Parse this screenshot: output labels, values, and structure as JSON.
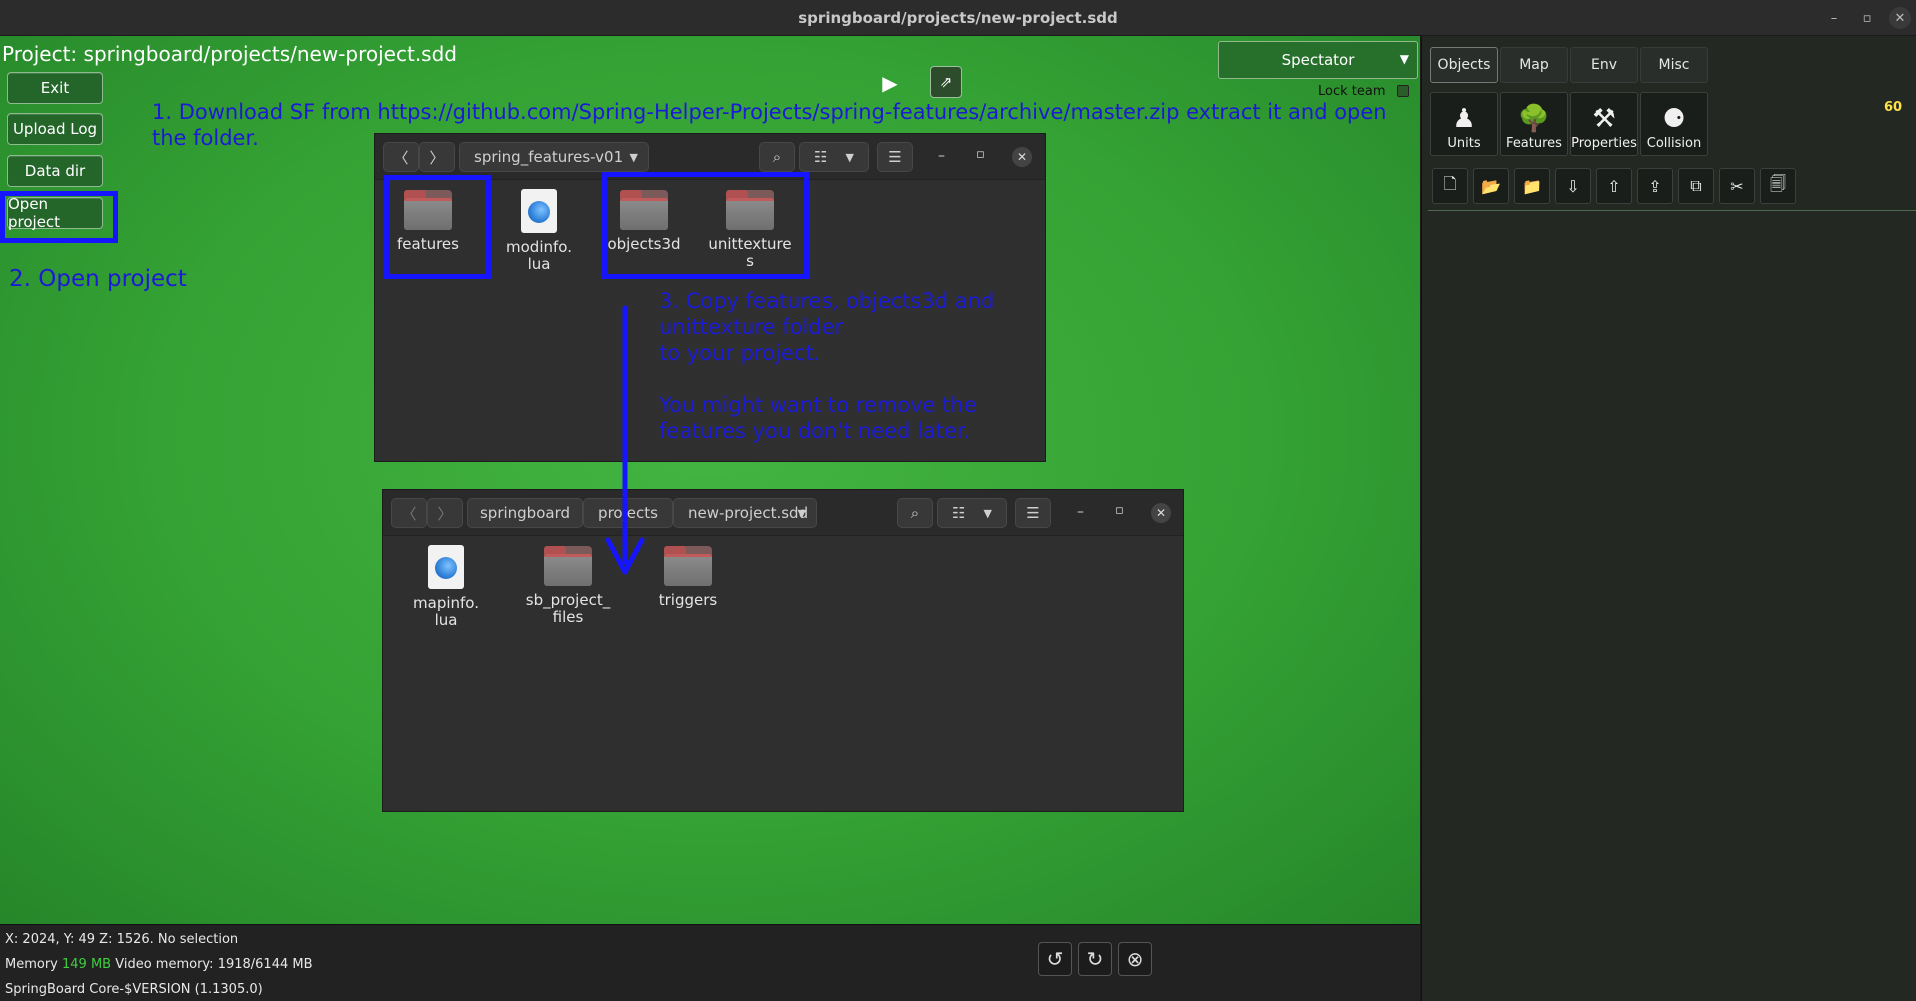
{
  "window": {
    "title": "springboard/projects/new-project.sdd",
    "controls": [
      "–",
      "▫",
      "✕"
    ]
  },
  "project_title": "Project: springboard/projects/new-project.sdd",
  "left_buttons": {
    "exit": "Exit",
    "upload_log": "Upload Log",
    "data_dir": "Data dir",
    "open_project": "Open project"
  },
  "toolbar": {
    "play": "▶",
    "tool": "⇗",
    "spectator": "Spectator",
    "lock_team": "Lock team",
    "fps": "60"
  },
  "annotations": {
    "step1": "1. Download SF from https://github.com/Spring-Helper-Projects/spring-features/archive/master.zip extract it and open the folder.",
    "step2": "2. Open project",
    "step3_l1": "3. Copy features, objects3d and",
    "step3_l2": "unittexture folder",
    "step3_l3": "to your project.",
    "step3_l4": "You might want to remove the",
    "step3_l5": "features you don't need later."
  },
  "fm1": {
    "path": "spring_features-v01",
    "items": [
      {
        "label": "features",
        "kind": "folder"
      },
      {
        "label": "modinfo.\nlua",
        "kind": "lua"
      },
      {
        "label": "objects3d",
        "kind": "folder"
      },
      {
        "label": "unittexture\ns",
        "kind": "folder"
      }
    ]
  },
  "fm2": {
    "crumbs": [
      "springboard",
      "projects",
      "new-project.sdd"
    ],
    "items": [
      {
        "label": "mapinfo.\nlua",
        "kind": "lua"
      },
      {
        "label": "sb_project_\nfiles",
        "kind": "folder"
      },
      {
        "label": "triggers",
        "kind": "folder"
      }
    ]
  },
  "rpanel": {
    "tabs": [
      "Objects",
      "Map",
      "Env",
      "Misc"
    ],
    "obj_buttons": [
      {
        "label": "Units",
        "icon": "♟"
      },
      {
        "label": "Features",
        "icon": "🌳"
      },
      {
        "label": "Properties",
        "icon": "⚒"
      },
      {
        "label": "Collision",
        "icon": "⚈"
      }
    ],
    "tools": [
      "🗋",
      "📂",
      "📁",
      "⇩",
      "⇧",
      "⇪",
      "⧉",
      "✂",
      "🗐"
    ]
  },
  "status": {
    "coords": "X: 2024, Y: 49 Z: 1526. No selection",
    "memory_label": "Memory",
    "memory_value": "149 MB",
    "video_memory": "Video memory: 1918/6144 MB",
    "version": "SpringBoard Core-$VERSION (1.1305.0)"
  },
  "bottom_controls": {
    "undo": "↺",
    "redo": "↻",
    "clear": "⊗"
  },
  "colors": {
    "viewport_green": "#34a234",
    "annotation_blue": "#1b1bd6",
    "box_blue": "#1515ff",
    "fps_yellow": "#ffe14a"
  }
}
